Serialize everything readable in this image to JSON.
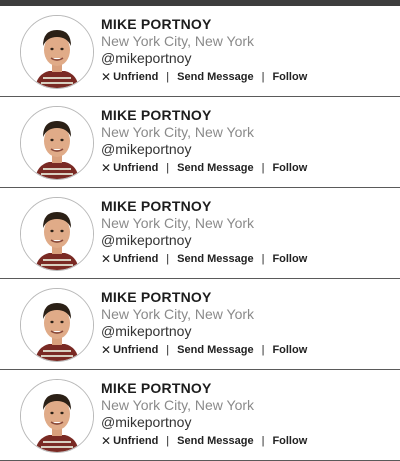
{
  "friends": [
    {
      "name": "MIKE PORTNOY",
      "location": "New York City, New York",
      "handle": "@mikeportnoy",
      "actions": {
        "unfriend": "Unfriend",
        "message": "Send Message",
        "follow": "Follow",
        "separator": "|"
      }
    },
    {
      "name": "MIKE PORTNOY",
      "location": "New York City, New York",
      "handle": "@mikeportnoy",
      "actions": {
        "unfriend": "Unfriend",
        "message": "Send Message",
        "follow": "Follow",
        "separator": "|"
      }
    },
    {
      "name": "MIKE PORTNOY",
      "location": "New York City, New York",
      "handle": "@mikeportnoy",
      "actions": {
        "unfriend": "Unfriend",
        "message": "Send Message",
        "follow": "Follow",
        "separator": "|"
      }
    },
    {
      "name": "MIKE PORTNOY",
      "location": "New York City, New York",
      "handle": "@mikeportnoy",
      "actions": {
        "unfriend": "Unfriend",
        "message": "Send Message",
        "follow": "Follow",
        "separator": "|"
      }
    },
    {
      "name": "MIKE PORTNOY",
      "location": "New York City, New York",
      "handle": "@mikeportnoy",
      "actions": {
        "unfriend": "Unfriend",
        "message": "Send Message",
        "follow": "Follow",
        "separator": "|"
      }
    }
  ],
  "icons": {
    "unfriend": "close-icon",
    "avatar": "user-photo"
  },
  "colors": {
    "topbar": "#3d3d3d",
    "divider": "#5a5a5a",
    "location_text": "#8a8a8a",
    "name_text": "#1d1d1d"
  }
}
